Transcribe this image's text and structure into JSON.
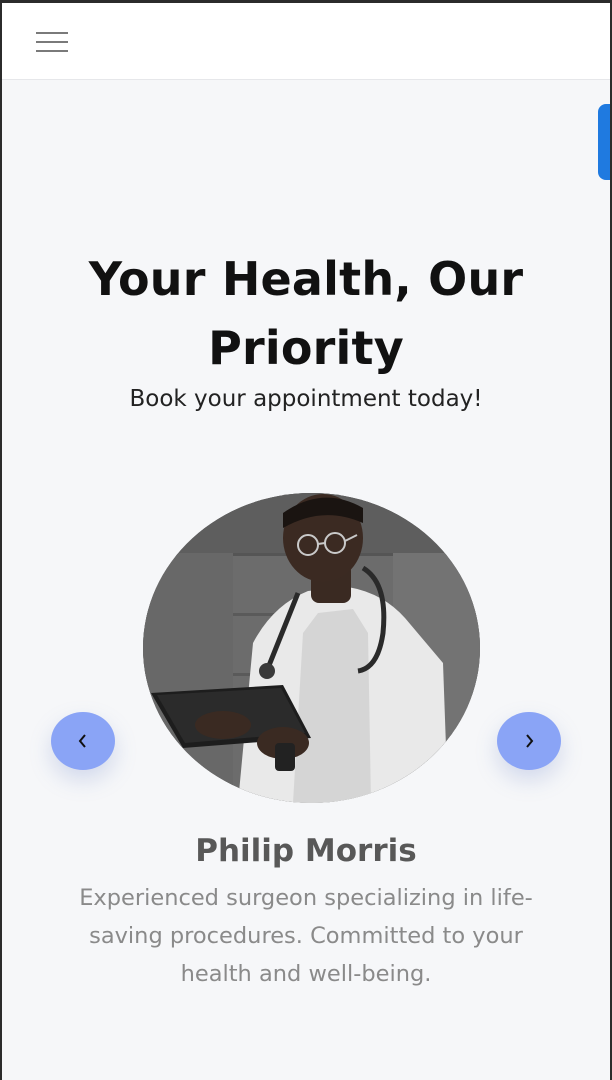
{
  "navbar": {
    "menu_icon": "hamburger-menu-icon"
  },
  "hero": {
    "title": "Your Health, Our Priority",
    "subtitle": "Book your appointment today!"
  },
  "carousel": {
    "prev_icon": "chevron-left-icon",
    "next_icon": "chevron-right-icon",
    "doctor": {
      "name": "Philip Morris",
      "description": "Experienced surgeon specializing in life-saving procedures. Committed to your health and well-being."
    }
  },
  "colors": {
    "accent": "#1f7ae0",
    "carousel_button": "#8aa4f6",
    "page_background": "#f6f7f9"
  }
}
